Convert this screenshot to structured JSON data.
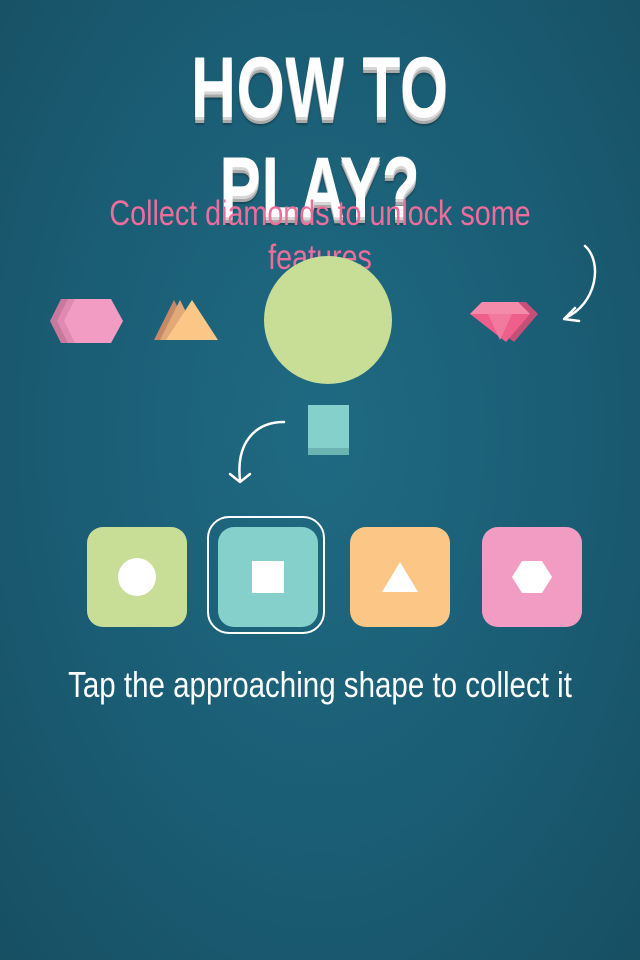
{
  "screen": {
    "title": "HOW TO PLAY?",
    "diamond_hint": "Collect diamonds to unlock some features",
    "tap_hint": "Tap the approaching shape to collect it"
  },
  "colors": {
    "background": "#1a5d74",
    "pink_text": "#ef6d9b",
    "green": "#c8de97",
    "teal": "#85d0cb",
    "orange": "#fcc686",
    "pink": "#f39cc3",
    "diamond": "#ee5f8c"
  },
  "floating_shapes": [
    "hexagon-stack-icon",
    "triangle-stack-icon",
    "big-circle",
    "diamond-icon"
  ],
  "shape_buttons": [
    {
      "shape": "circle",
      "color": "green"
    },
    {
      "shape": "square",
      "color": "teal",
      "selected": true
    },
    {
      "shape": "triangle",
      "color": "orange"
    },
    {
      "shape": "hexagon",
      "color": "pink"
    }
  ]
}
